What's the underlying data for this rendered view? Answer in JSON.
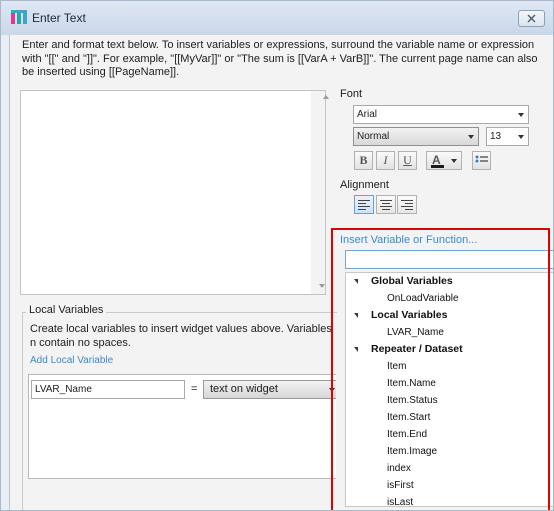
{
  "window": {
    "title": "Enter Text",
    "intro_text": "Enter and format text below. To insert variables or expressions, surround the variable name or expression with \"[[\" and \"]]\". For example, \"[[MyVar]]\" or \"The sum is [[VarA + VarB]]\". The current page name can also be inserted using [[PageName]]."
  },
  "font": {
    "label": "Font",
    "family": "Arial",
    "style": "Normal",
    "size": "13",
    "bold": "B",
    "italic": "I",
    "underline": "U",
    "color_glyph": "A",
    "color_swatch": "#1a1a1a"
  },
  "alignment": {
    "label": "Alignment",
    "active": "left"
  },
  "insert": {
    "link": "Insert Variable or Function...",
    "search_value": "",
    "groups": [
      {
        "label": "Global Variables",
        "items": [
          "OnLoadVariable"
        ]
      },
      {
        "label": "Local Variables",
        "items": [
          "LVAR_Name"
        ]
      },
      {
        "label": "Repeater / Dataset",
        "items": [
          "Item",
          "Item.Name",
          "Item.Status",
          "Item.Start",
          "Item.End",
          "Item.Image",
          "index",
          "isFirst",
          "isLast"
        ]
      }
    ]
  },
  "local": {
    "title": "Local Variables",
    "description": "Create local variables to insert widget values above. Variables n contain no spaces.",
    "add_link": "Add Local Variable",
    "rows": [
      {
        "name": "LVAR_Name",
        "eq": "=",
        "source": "text on widget"
      }
    ]
  },
  "colors": {
    "highlight_frame": "#e00000",
    "link": "#3a8ad0",
    "icon_pink": "#e5358f",
    "icon_teal": "#27a9a3",
    "icon_blue": "#3ba6c9"
  }
}
